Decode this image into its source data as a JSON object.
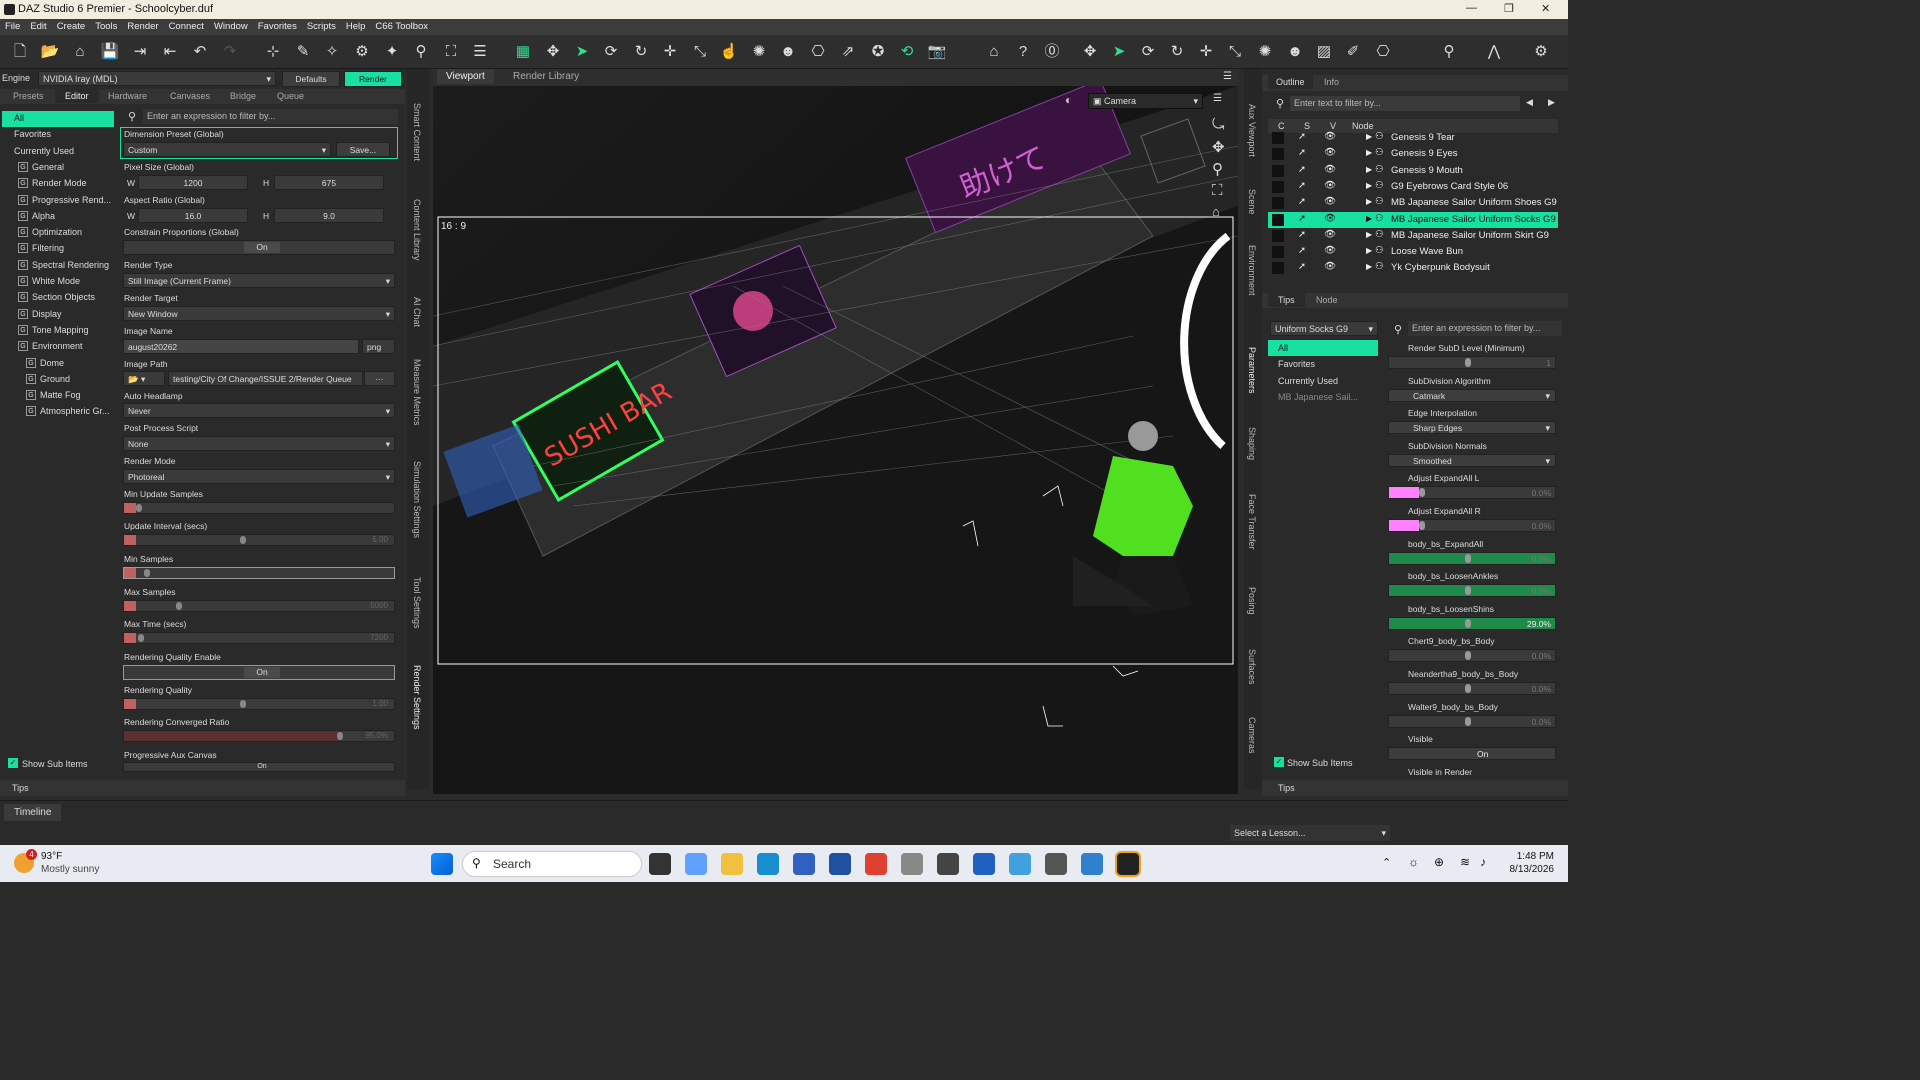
{
  "title": "DAZ Studio 6 Premier - Schoolcyber.duf",
  "window_controls": {
    "min": "—",
    "max": "❐",
    "close": "✕"
  },
  "menu": [
    "File",
    "Edit",
    "Create",
    "Tools",
    "Render",
    "Connect",
    "Window",
    "Favorites",
    "Scripts",
    "Help",
    "C66 Toolbox"
  ],
  "engine": {
    "label": "Engine",
    "value": "NVIDIA Iray (MDL)",
    "defaults": "Defaults",
    "render": "Render"
  },
  "left_tabs": [
    "Presets",
    "Editor",
    "Hardware",
    "Canvases",
    "Bridge",
    "Queue"
  ],
  "filter_placeholder": "Enter an expression to filter by...",
  "categories": [
    {
      "label": "All",
      "sel": true,
      "indent": 0
    },
    {
      "label": "Favorites",
      "indent": 0
    },
    {
      "label": "Currently Used",
      "indent": 0
    },
    {
      "label": "General",
      "indent": 1
    },
    {
      "label": "Render Mode",
      "indent": 1
    },
    {
      "label": "Progressive Rend...",
      "indent": 1
    },
    {
      "label": "Alpha",
      "indent": 1
    },
    {
      "label": "Optimization",
      "indent": 1
    },
    {
      "label": "Filtering",
      "indent": 1
    },
    {
      "label": "Spectral Rendering",
      "indent": 1
    },
    {
      "label": "White Mode",
      "indent": 1
    },
    {
      "label": "Section Objects",
      "indent": 1
    },
    {
      "label": "Display",
      "indent": 1
    },
    {
      "label": "Tone Mapping",
      "indent": 1
    },
    {
      "label": "Environment",
      "indent": 1
    },
    {
      "label": "Dome",
      "indent": 2
    },
    {
      "label": "Ground",
      "indent": 2
    },
    {
      "label": "Matte Fog",
      "indent": 2
    },
    {
      "label": "Atmospheric Gr...",
      "indent": 2
    }
  ],
  "settings": {
    "dim_preset": "Dimension Preset (Global)",
    "dim_value": "Custom",
    "save": "Save...",
    "pixel_size": "Pixel Size (Global)",
    "w": "W",
    "h": "H",
    "pw": "1200",
    "ph": "675",
    "aspect": "Aspect Ratio (Global)",
    "aw": "16.0",
    "ah": "9.0",
    "constrain": "Constrain Proportions (Global)",
    "on": "On",
    "render_type": "Render Type",
    "render_type_v": "Still Image (Current Frame)",
    "render_target": "Render Target",
    "render_target_v": "New Window",
    "image_name": "Image Name",
    "image_name_v": "august20262",
    "ext": "png",
    "image_path": "Image Path",
    "image_path_v": "testing/City Of Change/ISSUE 2/Render Queue",
    "auto_headlamp": "Auto Headlamp",
    "auto_headlamp_v": "Never",
    "post_script": "Post Process Script",
    "post_script_v": "None",
    "render_mode": "Render Mode",
    "render_mode_v": "Photoreal",
    "min_update": "Min Update Samples",
    "update_int": "Update Interval (secs)",
    "update_int_v": "5.00",
    "min_samples": "Min Samples",
    "max_samples": "Max Samples",
    "max_samples_v": "5000",
    "max_time": "Max Time (secs)",
    "max_time_v": "7200",
    "rq_enable": "Rendering Quality Enable",
    "rq": "Rendering Quality",
    "rq_v": "1.00",
    "rcr": "Rendering Converged Ratio",
    "rcr_v": "95.0%",
    "prog_aux": "Progressive Aux Canvas"
  },
  "show_sub": "Show Sub Items",
  "tips": "Tips",
  "side_tabs": [
    "Smart Content",
    "Content Library",
    "AI Chat",
    "Measure Metrics",
    "Simulation Settings",
    "Tool Settings",
    "Render Settings"
  ],
  "view_tabs": [
    "Viewport",
    "Render Library"
  ],
  "camera": "Camera",
  "aspect_label": "16 : 9",
  "outline_tabs": [
    "Outline",
    "Info"
  ],
  "outline_filter": "Enter text to filter by...",
  "outline_cols": [
    "C",
    "S",
    "V",
    "Node"
  ],
  "nodes": [
    "Genesis 9 Tear",
    "Genesis 9 Eyes",
    "Genesis 9 Mouth",
    "G9 Eyebrows Card Style 06",
    "MB Japanese Sailor Uniform Shoes G9",
    "MB Japanese Sailor Uniform Socks G9",
    "MB Japanese Sailor Uniform Skirt G9",
    "Loose Wave Bun",
    "Yk Cyberpunk Bodysuit"
  ],
  "selected_node": 5,
  "right_tabs2": [
    "Tips",
    "Node"
  ],
  "param_node": "Uniform Socks G9",
  "param_filter": "Enter an expression to filter by...",
  "param_cats": [
    "All",
    "Favorites",
    "Currently Used",
    "MB Japanese Sail..."
  ],
  "params": [
    {
      "label": "Render SubD Level (Minimum)",
      "type": "slider",
      "value": "1"
    },
    {
      "label": "SubDivision Algorithm",
      "type": "select",
      "value": "Catmark"
    },
    {
      "label": "Edge Interpolation",
      "type": "select",
      "value": "Sharp Edges"
    },
    {
      "label": "SubDivision Normals",
      "type": "select",
      "value": "Smoothed"
    },
    {
      "label": "Adjust ExpandAll L",
      "type": "pink",
      "value": "0.0%"
    },
    {
      "label": "Adjust ExpandAll R",
      "type": "pink",
      "value": "0.0%"
    },
    {
      "label": "body_bs_ExpandAll",
      "type": "green",
      "value": "0.0%"
    },
    {
      "label": "body_bs_LoosenAnkles",
      "type": "green",
      "value": "0.0%"
    },
    {
      "label": "body_bs_LoosenShins",
      "type": "green",
      "value": "29.0%"
    },
    {
      "label": "Chert9_body_bs_Body",
      "type": "slider",
      "value": "0.0%"
    },
    {
      "label": "Neandertha9_body_bs_Body",
      "type": "slider",
      "value": "0.0%"
    },
    {
      "label": "Walter9_body_bs_Body",
      "type": "slider",
      "value": "0.0%"
    },
    {
      "label": "Visible",
      "type": "toggle",
      "value": "On"
    },
    {
      "label": "Visible in Render",
      "type": "none",
      "value": ""
    }
  ],
  "right_side_tabs": [
    "Aux Viewport",
    "Scene",
    "Environment",
    "Parameters",
    "Shaping",
    "Face Transfer",
    "Posing",
    "Surfaces",
    "Cameras"
  ],
  "timeline": "Timeline",
  "lesson": "Select a Lesson...",
  "weather": {
    "temp": "93°F",
    "desc": "Mostly sunny",
    "badge": "4"
  },
  "search": "Search",
  "clock": {
    "time": "1:48 PM",
    "date": "8/13/2026"
  },
  "colors": {
    "accent": "#18e0a0",
    "pink": "#ff80ff",
    "green": "#1f8a4a"
  }
}
